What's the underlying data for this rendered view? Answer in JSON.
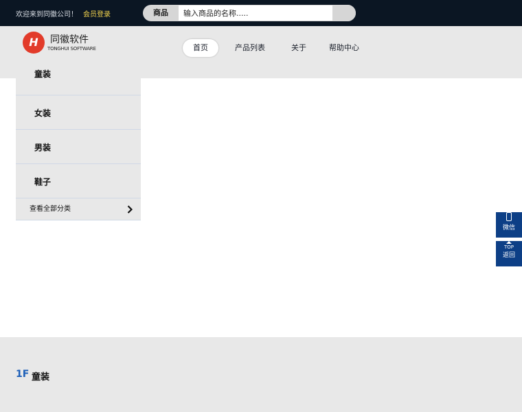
{
  "topbar": {
    "welcome": "欢迎来到同徽公司！",
    "login": "会员登录"
  },
  "search": {
    "scope": "商品",
    "placeholder": "输入商品的名称....."
  },
  "logo": {
    "mark": "H",
    "cn": "同徽软件",
    "en": "TONGHUI SOFTWARE"
  },
  "nav": {
    "items": [
      "首页",
      "产品列表",
      "关于",
      "帮助中心"
    ],
    "active_index": 0
  },
  "categories": {
    "items": [
      "童装",
      "女装",
      "男装",
      "鞋子"
    ],
    "view_all": "查看全部分类"
  },
  "floor": {
    "num": "1F",
    "title": "童装"
  },
  "side": {
    "wechat": "微信",
    "top": "TOP",
    "back": "返回"
  },
  "colors": {
    "topbar": "#0b1623",
    "header": "#e8e8e8",
    "accent_blue": "#0d3f86",
    "floor_number": "#1d5fb8",
    "login_yellow": "#f2d34d"
  }
}
